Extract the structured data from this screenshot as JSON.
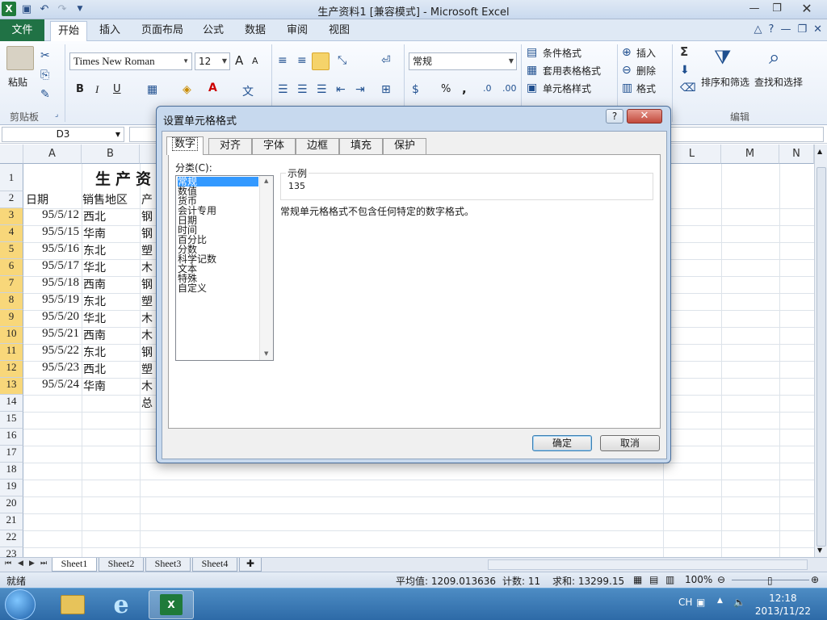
{
  "window": {
    "title": "生产资料1 [兼容模式] - Microsoft Excel",
    "logo": "X"
  },
  "ribbon_tabs": [
    "文件",
    "开始",
    "插入",
    "页面布局",
    "公式",
    "数据",
    "审阅",
    "视图"
  ],
  "ribbon": {
    "paste": "粘贴",
    "font_name": "Times New Roman",
    "font_size": "12",
    "bold": "B",
    "italic": "I",
    "underline": "U",
    "font_grow": "A",
    "font_shrink": "A",
    "number_format": "常规",
    "percent": "%",
    "comma": ",",
    "conditional_format": "条件格式",
    "table_format": "套用表格格式",
    "cell_styles": "单元格样式",
    "insert": "插入",
    "delete": "删除",
    "format": "格式",
    "sum_symbol": "Σ",
    "sort_filter": "排序和筛选",
    "find_select": "查找和选择",
    "groups": {
      "clipboard": "剪贴板",
      "edit": "编辑"
    }
  },
  "name_box": "D3",
  "columns": [
    "A",
    "B",
    "L",
    "M",
    "N"
  ],
  "rows": [
    "1",
    "2",
    "3",
    "4",
    "5",
    "6",
    "7",
    "8",
    "9",
    "10",
    "11",
    "12",
    "13",
    "14",
    "15",
    "16",
    "17",
    "18",
    "19",
    "20",
    "21",
    "22",
    "23"
  ],
  "sheet_title": "生产资",
  "headers": {
    "date": "日期",
    "region": "销售地区",
    "product": "产"
  },
  "data_rows": [
    {
      "date": "95/5/12",
      "region": "西北",
      "product": "钢"
    },
    {
      "date": "95/5/15",
      "region": "华南",
      "product": "钢"
    },
    {
      "date": "95/5/16",
      "region": "东北",
      "product": "塑"
    },
    {
      "date": "95/5/17",
      "region": "华北",
      "product": "木"
    },
    {
      "date": "95/5/18",
      "region": "西南",
      "product": "钢"
    },
    {
      "date": "95/5/19",
      "region": "东北",
      "product": "塑"
    },
    {
      "date": "95/5/20",
      "region": "华北",
      "product": "木"
    },
    {
      "date": "95/5/21",
      "region": "西南",
      "product": "木"
    },
    {
      "date": "95/5/22",
      "region": "东北",
      "product": "钢"
    },
    {
      "date": "95/5/23",
      "region": "西北",
      "product": "塑"
    },
    {
      "date": "95/5/24",
      "region": "华南",
      "product": "木"
    }
  ],
  "total_label": "总",
  "sheet_tabs": [
    "Sheet1",
    "Sheet2",
    "Sheet3",
    "Sheet4"
  ],
  "status": {
    "ready": "就绪",
    "average": "平均值: 1209.013636",
    "count": "计数: 11",
    "sum": "求和: 13299.15",
    "zoom": "100%"
  },
  "taskbar": {
    "ime": "CH",
    "time": "12:18",
    "date": "2013/11/22"
  },
  "dialog": {
    "title": "设置单元格格式",
    "help": "?",
    "tabs": [
      "数字",
      "对齐",
      "字体",
      "边框",
      "填充",
      "保护"
    ],
    "category_label": "分类(C):",
    "categories": [
      "常规",
      "数值",
      "货币",
      "会计专用",
      "日期",
      "时间",
      "百分比",
      "分数",
      "科学记数",
      "文本",
      "特殊",
      "自定义"
    ],
    "selected_category": "常规",
    "sample_label": "示例",
    "sample_value": "135",
    "description": "常规单元格格式不包含任何特定的数字格式。",
    "ok": "确定",
    "cancel": "取消"
  },
  "colors": {
    "excel_green": "#207245",
    "selected_row_header": "#f8d77a",
    "selection_blue": "#3399ff"
  }
}
